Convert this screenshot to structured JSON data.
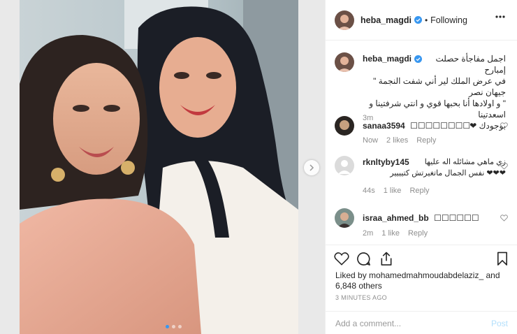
{
  "post": {
    "username": "heba_magdi",
    "follow_status": "Following",
    "more_icon": "more-options-icon",
    "separator": "•"
  },
  "caption": {
    "username": "heba_magdi",
    "lines": [
      "اجمل مفاجأة حصلت إمبارح",
      "في عرض الملك لير أني شفت النجمة \" جيهان نصر",
      "\" و اولادها أنا بحبها قوي و انتي شرفتينا و اسعدتينا",
      "بوجودك ❤"
    ],
    "time": "3m"
  },
  "comments": [
    {
      "username": "sanaa3594",
      "text": "☐☐☐☐☐☐☐☐",
      "time": "Now",
      "likes": "2 likes",
      "reply": "Reply"
    },
    {
      "username": "rknltyby145",
      "text_line1": "زي ماهي مشائله اله عليها",
      "text_line2": "❤❤❤ نفس الجمال ماتغيرتش كتيييير",
      "time": "44s",
      "likes": "1 like",
      "reply": "Reply"
    },
    {
      "username": "israa_ahmed_bb",
      "text": "☐☐☐☐☐☐",
      "time": "2m",
      "likes": "1 like",
      "reply": "Reply"
    }
  ],
  "likes": {
    "prefix": "Liked by ",
    "liker": "mohamedmahmoudabdelaziz_",
    "joiner": " and ",
    "others": "6,848 others"
  },
  "timestamp": "3 MINUTES AGO",
  "add_comment": {
    "placeholder": "Add a comment...",
    "post_label": "Post"
  },
  "colors": {
    "verified": "#3897f0",
    "link_post_disabled": "#b2dffc",
    "meta_gray": "#8e8e8e",
    "text": "#262626"
  },
  "carousel": {
    "count": 3,
    "active": 0
  }
}
